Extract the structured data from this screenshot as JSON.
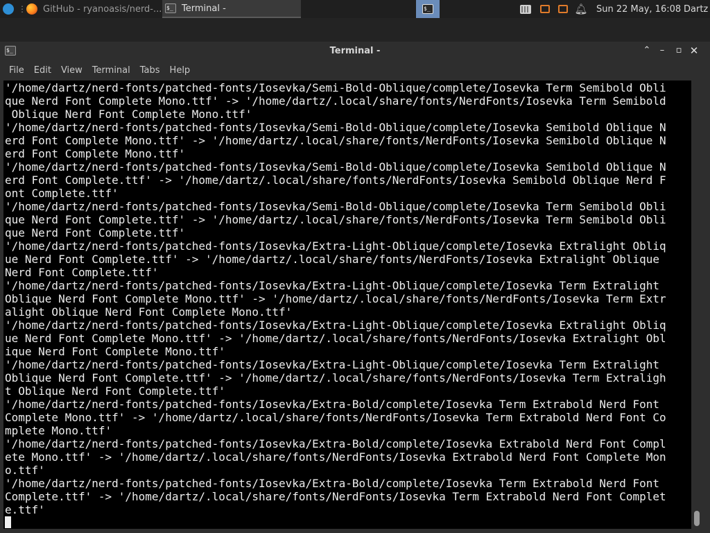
{
  "panel": {
    "taskbar": {
      "github_label": "GitHub - ryanoasis/nerd-...",
      "terminal_label": "Terminal -",
      "separator": "⋮"
    },
    "clock": "Sun 22 May, 16:08",
    "user": "Dartz",
    "icons": {
      "menu": "xfce-mouse-icon",
      "browser": "firefox-icon",
      "terminal": "terminal-icon",
      "network": "network-icon",
      "notify": "bell-icon"
    }
  },
  "window": {
    "title": "Terminal -",
    "controls": {
      "shade": "⌃",
      "minimize": "–",
      "maximize": "▫",
      "close": "✕"
    },
    "icon_text": "$_"
  },
  "menu": [
    "File",
    "Edit",
    "View",
    "Terminal",
    "Tabs",
    "Help"
  ],
  "terminal": {
    "lines": [
      "'/home/dartz/nerd-fonts/patched-fonts/Iosevka/Semi-Bold-Oblique/complete/Iosevka Term Semibold Obli",
      "que Nerd Font Complete Mono.ttf' -> '/home/dartz/.local/share/fonts/NerdFonts/Iosevka Term Semibold",
      " Oblique Nerd Font Complete Mono.ttf'",
      "'/home/dartz/nerd-fonts/patched-fonts/Iosevka/Semi-Bold-Oblique/complete/Iosevka Semibold Oblique N",
      "erd Font Complete Mono.ttf' -> '/home/dartz/.local/share/fonts/NerdFonts/Iosevka Semibold Oblique N",
      "erd Font Complete Mono.ttf'",
      "'/home/dartz/nerd-fonts/patched-fonts/Iosevka/Semi-Bold-Oblique/complete/Iosevka Semibold Oblique N",
      "erd Font Complete.ttf' -> '/home/dartz/.local/share/fonts/NerdFonts/Iosevka Semibold Oblique Nerd F",
      "ont Complete.ttf'",
      "'/home/dartz/nerd-fonts/patched-fonts/Iosevka/Semi-Bold-Oblique/complete/Iosevka Term Semibold Obli",
      "que Nerd Font Complete.ttf' -> '/home/dartz/.local/share/fonts/NerdFonts/Iosevka Term Semibold Obli",
      "que Nerd Font Complete.ttf'",
      "'/home/dartz/nerd-fonts/patched-fonts/Iosevka/Extra-Light-Oblique/complete/Iosevka Extralight Obliq",
      "ue Nerd Font Complete.ttf' -> '/home/dartz/.local/share/fonts/NerdFonts/Iosevka Extralight Oblique",
      "Nerd Font Complete.ttf'",
      "'/home/dartz/nerd-fonts/patched-fonts/Iosevka/Extra-Light-Oblique/complete/Iosevka Term Extralight",
      "Oblique Nerd Font Complete Mono.ttf' -> '/home/dartz/.local/share/fonts/NerdFonts/Iosevka Term Extr",
      "alight Oblique Nerd Font Complete Mono.ttf'",
      "'/home/dartz/nerd-fonts/patched-fonts/Iosevka/Extra-Light-Oblique/complete/Iosevka Extralight Obliq",
      "ue Nerd Font Complete Mono.ttf' -> '/home/dartz/.local/share/fonts/NerdFonts/Iosevka Extralight Obl",
      "ique Nerd Font Complete Mono.ttf'",
      "'/home/dartz/nerd-fonts/patched-fonts/Iosevka/Extra-Light-Oblique/complete/Iosevka Term Extralight",
      "Oblique Nerd Font Complete.ttf' -> '/home/dartz/.local/share/fonts/NerdFonts/Iosevka Term Extraligh",
      "t Oblique Nerd Font Complete.ttf'",
      "'/home/dartz/nerd-fonts/patched-fonts/Iosevka/Extra-Bold/complete/Iosevka Term Extrabold Nerd Font",
      "Complete Mono.ttf' -> '/home/dartz/.local/share/fonts/NerdFonts/Iosevka Term Extrabold Nerd Font Co",
      "mplete Mono.ttf'",
      "'/home/dartz/nerd-fonts/patched-fonts/Iosevka/Extra-Bold/complete/Iosevka Extrabold Nerd Font Compl",
      "ete Mono.ttf' -> '/home/dartz/.local/share/fonts/NerdFonts/Iosevka Extrabold Nerd Font Complete Mon",
      "o.ttf'",
      "'/home/dartz/nerd-fonts/patched-fonts/Iosevka/Extra-Bold/complete/Iosevka Term Extrabold Nerd Font",
      "Complete.ttf' -> '/home/dartz/.local/share/fonts/NerdFonts/Iosevka Term Extrabold Nerd Font Complet",
      "e.ttf'"
    ]
  },
  "colors": {
    "terminal_bg": "#000000",
    "terminal_fg": "#ececec",
    "chrome_bg": "#2e2e2e",
    "workspace_active": "#6a8cba",
    "tray_accent": "#e07b2a"
  }
}
